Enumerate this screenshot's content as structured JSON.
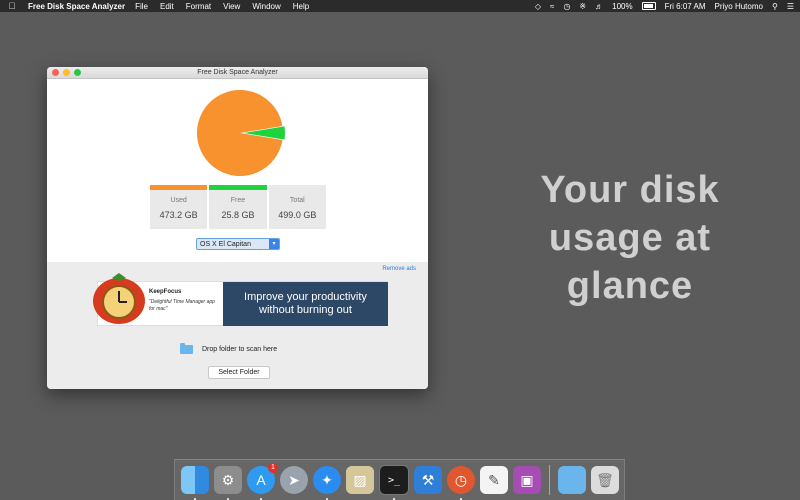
{
  "menubar": {
    "app_name": "Free Disk Space Analyzer",
    "items": [
      "File",
      "Edit",
      "Format",
      "View",
      "Window",
      "Help"
    ],
    "battery": "100%",
    "clock": "Fri 6:07 AM",
    "user": "Priyo Hutomo"
  },
  "tagline": "Your disk usage at glance",
  "window": {
    "title": "Free Disk Space Analyzer",
    "colors": {
      "used": "#f7922f",
      "free": "#1ed33c"
    },
    "disk_usage": {
      "used_fraction": 0.948,
      "free_fraction": 0.052
    },
    "stats": [
      {
        "label": "Used",
        "value": "473.2 GB"
      },
      {
        "label": "Free",
        "value": "25.8 GB"
      },
      {
        "label": "Total",
        "value": "499.0 GB"
      }
    ],
    "volume_select": "OS X El Capitan",
    "remove_ads": "Remove ads",
    "ad": {
      "brand": "KeepFocus",
      "quote": "\"Delightful Time Manager app for mac\"",
      "banner": "Improve your productivity\nwithout burning out"
    },
    "drop_label": "Drop folder to scan here",
    "select_button": "Select Folder"
  },
  "dock": {
    "icons": [
      "finder-icon",
      "system-preferences-icon",
      "app-store-icon",
      "launchpad-icon",
      "safari-icon",
      "preview-icon",
      "terminal-icon",
      "xcode-icon",
      "keepfocus-icon",
      "textedit-icon",
      "photo-icon",
      "downloads-folder-icon",
      "trash-icon"
    ],
    "app_store_badge": "1"
  }
}
